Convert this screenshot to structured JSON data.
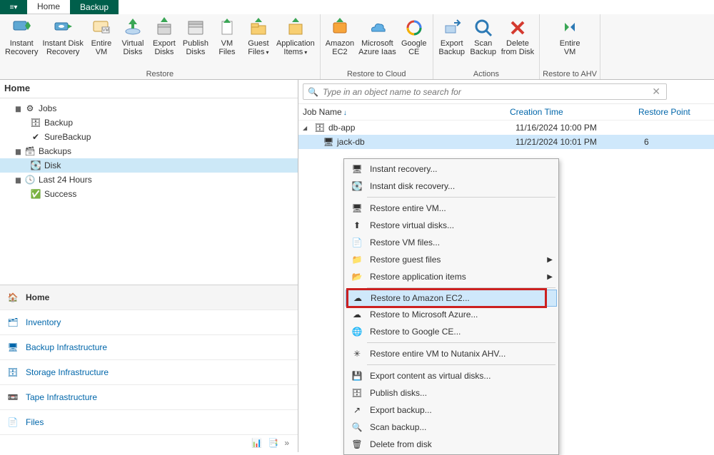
{
  "tabs": {
    "home": "Home",
    "backup": "Backup"
  },
  "ribbon": {
    "restore": {
      "label": "Restore",
      "instant_recovery": "Instant\nRecovery",
      "instant_disk_recovery": "Instant Disk\nRecovery",
      "entire_vm": "Entire\nVM",
      "virtual_disks": "Virtual\nDisks",
      "export_disks": "Export\nDisks",
      "publish_disks": "Publish\nDisks",
      "vm_files": "VM\nFiles",
      "guest_files": "Guest\nFiles",
      "application_items": "Application\nItems"
    },
    "restore_cloud": {
      "label": "Restore to Cloud",
      "amazon_ec2": "Amazon\nEC2",
      "microsoft_azure": "Microsoft\nAzure Iaas",
      "google_ce": "Google\nCE"
    },
    "actions": {
      "label": "Actions",
      "export_backup": "Export\nBackup",
      "scan_backup": "Scan\nBackup",
      "delete_from_disk": "Delete\nfrom Disk"
    },
    "restore_ahv": {
      "label": "Restore to AHV",
      "entire_vm": "Entire\nVM"
    }
  },
  "sidebar": {
    "title": "Home",
    "tree": {
      "jobs": "Jobs",
      "backup": "Backup",
      "surebackup": "SureBackup",
      "backups": "Backups",
      "disk": "Disk",
      "last24": "Last 24 Hours",
      "success": "Success"
    },
    "nav": {
      "home": "Home",
      "inventory": "Inventory",
      "backup_infra": "Backup Infrastructure",
      "storage_infra": "Storage Infrastructure",
      "tape_infra": "Tape Infrastructure",
      "files": "Files"
    }
  },
  "content": {
    "search_placeholder": "Type in an object name to search for",
    "columns": {
      "job_name": "Job Name",
      "creation_time": "Creation Time",
      "restore_point": "Restore Point"
    },
    "rows": [
      {
        "name": "db-app",
        "time": "11/16/2024 10:00 PM",
        "rp": ""
      },
      {
        "name": "jack-db",
        "time": "11/21/2024 10:01 PM",
        "rp": "6"
      }
    ]
  },
  "context_menu": {
    "instant_recovery": "Instant recovery...",
    "instant_disk_recovery": "Instant disk recovery...",
    "restore_entire_vm": "Restore entire VM...",
    "restore_virtual_disks": "Restore virtual disks...",
    "restore_vm_files": "Restore VM files...",
    "restore_guest_files": "Restore guest files",
    "restore_application_items": "Restore application items",
    "restore_amazon_ec2": "Restore to Amazon EC2...",
    "restore_microsoft_azure": "Restore to Microsoft Azure...",
    "restore_google_ce": "Restore to Google CE...",
    "restore_nutanix": "Restore entire VM to Nutanix AHV...",
    "export_virtual_disks": "Export content as virtual disks...",
    "publish_disks": "Publish disks...",
    "export_backup": "Export backup...",
    "scan_backup": "Scan backup...",
    "delete_from_disk": "Delete from disk"
  }
}
